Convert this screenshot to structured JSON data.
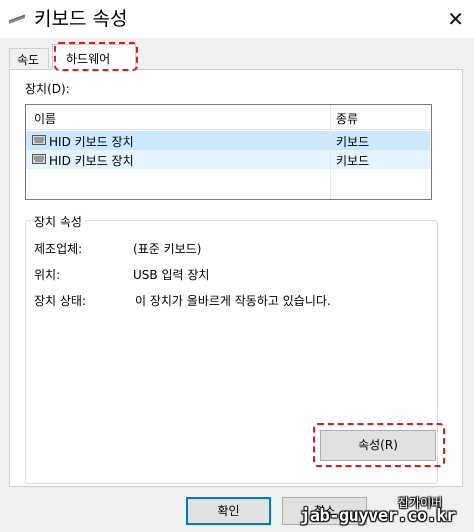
{
  "window": {
    "title": "키보드 속성",
    "close_icon": "close-icon"
  },
  "tabs": [
    {
      "label": "속도",
      "selected": false
    },
    {
      "label": "하드웨어",
      "selected": true
    }
  ],
  "devices": {
    "label": "장치(D):",
    "columns": [
      "이름",
      "종류"
    ],
    "rows": [
      {
        "name": "HID 키보드 장치",
        "type": "키보드",
        "icon": "keyboard-icon"
      },
      {
        "name": "HID 키보드 장치",
        "type": "키보드",
        "icon": "keyboard-icon"
      }
    ]
  },
  "properties": {
    "title": "장치 속성",
    "manufacturer_label": "제조업체:",
    "manufacturer_value": "(표준 키보드)",
    "location_label": "위치:",
    "location_value": "USB 입력 장치",
    "status_label": "장치 상태:",
    "status_value": "이 장치가 올바르게 작동하고 있습니다.",
    "properties_button": "속성(R)"
  },
  "footer": {
    "ok_label": "확인",
    "cancel_label": "취소"
  },
  "watermark": {
    "name": "잡가이버",
    "url": "jab-guyver.co.kr"
  },
  "colors": {
    "highlight": "#e3191b",
    "selected_row": "#cce8ff",
    "focus_border": "#0078d7"
  }
}
